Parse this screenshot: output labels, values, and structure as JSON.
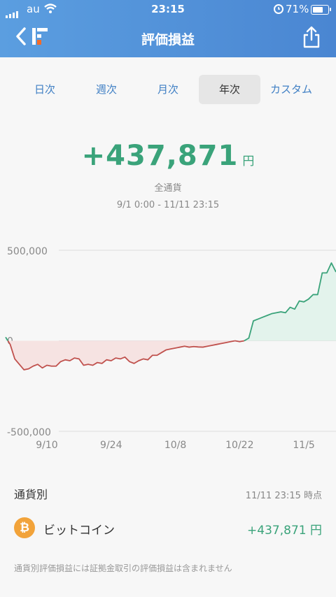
{
  "status": {
    "carrier": "au",
    "time": "23:15",
    "battery": "71%",
    "battery_level": 0.71
  },
  "header": {
    "title": "評価損益"
  },
  "tabs": [
    {
      "label": "日次",
      "active": false
    },
    {
      "label": "週次",
      "active": false
    },
    {
      "label": "月次",
      "active": false
    },
    {
      "label": "年次",
      "active": true
    },
    {
      "label": "カスタム",
      "active": false
    }
  ],
  "summary": {
    "amount": "+437,871",
    "unit": "円",
    "currency_label": "全通貨",
    "period": "9/1 0:00 - 11/11 23:15"
  },
  "colors": {
    "accent": "#3f7fc4",
    "gain": "#3aa37a",
    "loss": "#c0514d",
    "header": "#4a86d2"
  },
  "chart_data": {
    "type": "area",
    "y_tick_labels": [
      "500,000",
      "0",
      "-500,000"
    ],
    "y_ticks": [
      500000,
      0,
      -500000
    ],
    "x_tick_labels": [
      "9/10",
      "9/24",
      "10/8",
      "10/22",
      "11/5"
    ],
    "x_tick_days": [
      9,
      23,
      37,
      51,
      65
    ],
    "ylim": [
      -500000,
      500000
    ],
    "xlim": [
      0,
      72
    ],
    "grid": true,
    "x": [
      0,
      1,
      2,
      3,
      4,
      5,
      6,
      7,
      8,
      9,
      10,
      11,
      12,
      13,
      14,
      15,
      16,
      17,
      18,
      19,
      20,
      21,
      22,
      23,
      24,
      25,
      26,
      27,
      28,
      29,
      30,
      31,
      32,
      33,
      34,
      35,
      36,
      37,
      38,
      39,
      40,
      41,
      42,
      43,
      44,
      45,
      46,
      47,
      48,
      49,
      50,
      51,
      52,
      53,
      54,
      55,
      56,
      57,
      58,
      59,
      60,
      61,
      62,
      63,
      64,
      65,
      66,
      67,
      68,
      69,
      70,
      71,
      72
    ],
    "y": [
      20000,
      -20000,
      -100000,
      -130000,
      -160000,
      -155000,
      -140000,
      -130000,
      -150000,
      -135000,
      -140000,
      -140000,
      -115000,
      -105000,
      -110000,
      -95000,
      -100000,
      -135000,
      -130000,
      -135000,
      -120000,
      -125000,
      -105000,
      -110000,
      -95000,
      -100000,
      -90000,
      -115000,
      -125000,
      -110000,
      -100000,
      -105000,
      -80000,
      -80000,
      -65000,
      -50000,
      -45000,
      -40000,
      -35000,
      -30000,
      -35000,
      -32000,
      -34000,
      -35000,
      -30000,
      -25000,
      -20000,
      -15000,
      -10000,
      -5000,
      0,
      -5000,
      0,
      15000,
      110000,
      120000,
      130000,
      140000,
      150000,
      155000,
      160000,
      155000,
      185000,
      175000,
      220000,
      215000,
      230000,
      255000,
      255000,
      375000,
      375000,
      430000,
      380000
    ]
  },
  "breakdown": {
    "title": "通貨別",
    "as_of": "11/11 23:15 時点",
    "items": [
      {
        "symbol": "₿",
        "name": "ビットコイン",
        "value": "+437,871 円"
      }
    ],
    "note": "通貨別評価損益には証拠金取引の評価損益は含まれません"
  }
}
